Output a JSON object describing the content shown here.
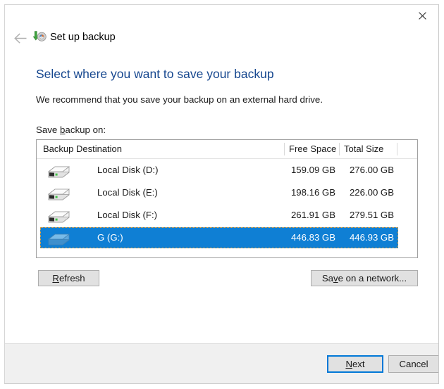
{
  "window": {
    "app_title": "Set up backup",
    "app_icon": "backup-drive-icon",
    "close_icon": "close-icon",
    "back_icon": "back-arrow-icon"
  },
  "page": {
    "heading": "Select where you want to save your backup",
    "heading_color": "#16478f",
    "subtext": "We recommend that you save your backup on an external hard drive.",
    "list_label_pre": "Save ",
    "list_label_accel": "b",
    "list_label_post": "ackup on:"
  },
  "table": {
    "columns": [
      "Backup Destination",
      "Free Space",
      "Total Size"
    ],
    "rows": [
      {
        "name": "Local Disk (D:)",
        "free_space": "159.09 GB",
        "total_size": "276.00 GB",
        "icon": "hard-drive-icon",
        "selected": false
      },
      {
        "name": "Local Disk (E:)",
        "free_space": "198.16 GB",
        "total_size": "226.00 GB",
        "icon": "hard-drive-icon",
        "selected": false
      },
      {
        "name": "Local Disk (F:)",
        "free_space": "261.91 GB",
        "total_size": "279.51 GB",
        "icon": "hard-drive-icon",
        "selected": false
      },
      {
        "name": "G (G:)",
        "free_space": "446.83 GB",
        "total_size": "446.93 GB",
        "icon": "hard-drive-icon",
        "selected": true
      }
    ],
    "selection_color": "#0f7fd4"
  },
  "buttons": {
    "refresh_pre": "",
    "refresh_accel": "R",
    "refresh_post": "efresh",
    "network_pre": "Sa",
    "network_accel": "v",
    "network_post": "e on a network...",
    "next_pre": "",
    "next_accel": "N",
    "next_post": "ext",
    "cancel": "Cancel",
    "default_button_border": "#0078d7"
  }
}
